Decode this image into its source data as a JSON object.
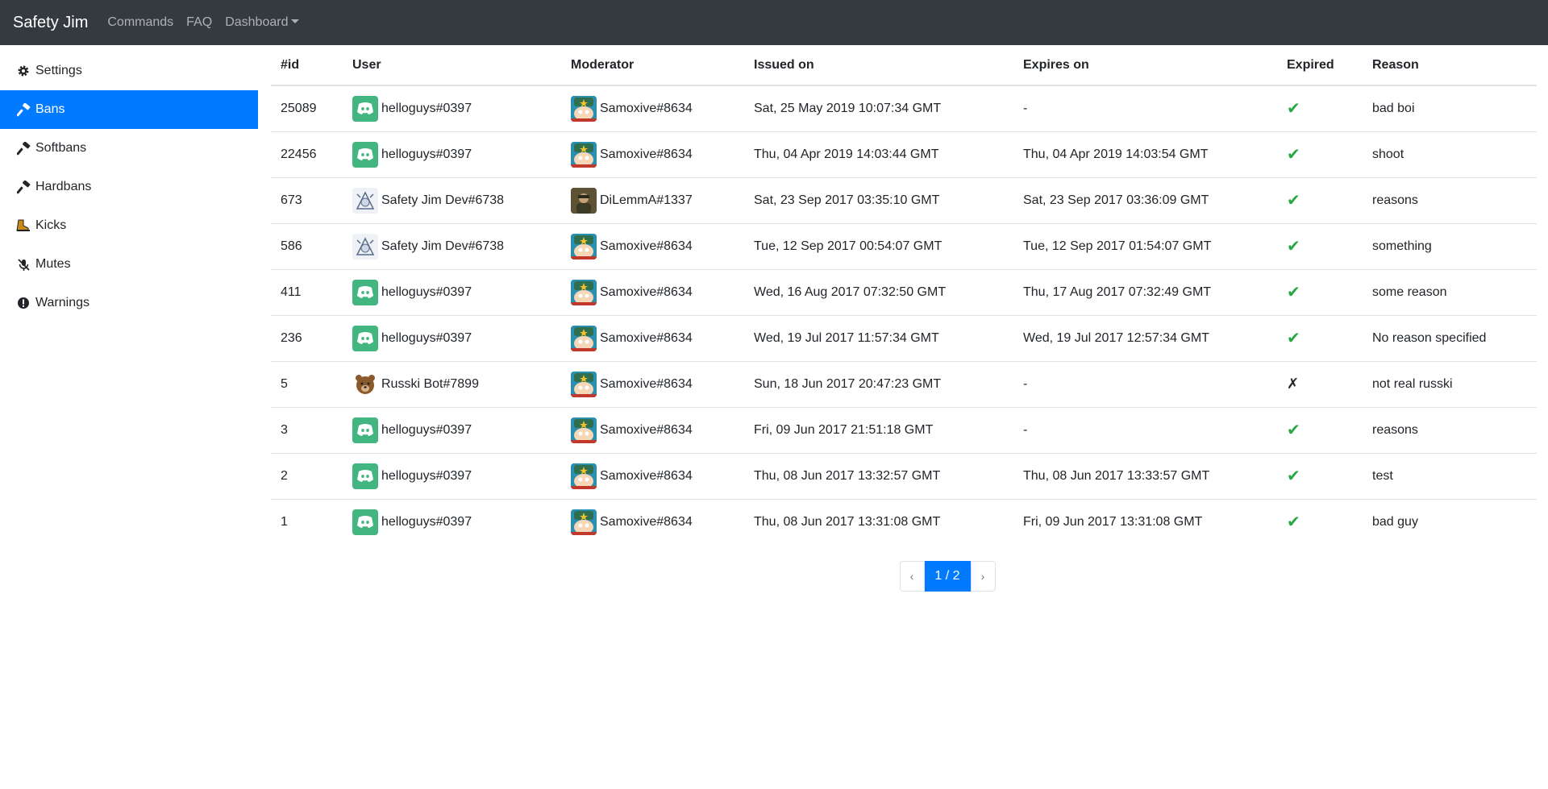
{
  "navbar": {
    "brand": "Safety Jim",
    "links": [
      "Commands",
      "FAQ"
    ],
    "dashboard": "Dashboard"
  },
  "sidebar": {
    "items": [
      {
        "label": "Settings",
        "icon": "gear-icon"
      },
      {
        "label": "Bans",
        "icon": "hammer-icon",
        "active": true
      },
      {
        "label": "Softbans",
        "icon": "hammer-icon"
      },
      {
        "label": "Hardbans",
        "icon": "hammer-icon"
      },
      {
        "label": "Kicks",
        "icon": "boot-icon"
      },
      {
        "label": "Mutes",
        "icon": "muted-mic-icon"
      },
      {
        "label": "Warnings",
        "icon": "exclamation-icon"
      }
    ]
  },
  "table": {
    "headers": [
      "#id",
      "User",
      "Moderator",
      "Issued on",
      "Expires on",
      "Expired",
      "Reason"
    ],
    "rows": [
      {
        "id": "25089",
        "user": "helloguys#0397",
        "user_avatar": "discord",
        "moderator": "Samoxive#8634",
        "mod_avatar": "samo",
        "issued": "Sat, 25 May 2019 10:07:34 GMT",
        "expires": "-",
        "expired": "✔",
        "reason": "bad boi"
      },
      {
        "id": "22456",
        "user": "helloguys#0397",
        "user_avatar": "discord",
        "moderator": "Samoxive#8634",
        "mod_avatar": "samo",
        "issued": "Thu, 04 Apr 2019 14:03:44 GMT",
        "expires": "Thu, 04 Apr 2019 14:03:54 GMT",
        "expired": "✔",
        "reason": "shoot"
      },
      {
        "id": "673",
        "user": "Safety Jim Dev#6738",
        "user_avatar": "dev",
        "moderator": "DiLemmA#1337",
        "mod_avatar": "dilemma",
        "issued": "Sat, 23 Sep 2017 03:35:10 GMT",
        "expires": "Sat, 23 Sep 2017 03:36:09 GMT",
        "expired": "✔",
        "reason": "reasons"
      },
      {
        "id": "586",
        "user": "Safety Jim Dev#6738",
        "user_avatar": "dev",
        "moderator": "Samoxive#8634",
        "mod_avatar": "samo",
        "issued": "Tue, 12 Sep 2017 00:54:07 GMT",
        "expires": "Tue, 12 Sep 2017 01:54:07 GMT",
        "expired": "✔",
        "reason": "something"
      },
      {
        "id": "411",
        "user": "helloguys#0397",
        "user_avatar": "discord",
        "moderator": "Samoxive#8634",
        "mod_avatar": "samo",
        "issued": "Wed, 16 Aug 2017 07:32:50 GMT",
        "expires": "Thu, 17 Aug 2017 07:32:49 GMT",
        "expired": "✔",
        "reason": "some reason"
      },
      {
        "id": "236",
        "user": "helloguys#0397",
        "user_avatar": "discord",
        "moderator": "Samoxive#8634",
        "mod_avatar": "samo",
        "issued": "Wed, 19 Jul 2017 11:57:34 GMT",
        "expires": "Wed, 19 Jul 2017 12:57:34 GMT",
        "expired": "✔",
        "reason": "No reason specified"
      },
      {
        "id": "5",
        "user": "Russki Bot#7899",
        "user_avatar": "bear",
        "moderator": "Samoxive#8634",
        "mod_avatar": "samo",
        "issued": "Sun, 18 Jun 2017 20:47:23 GMT",
        "expires": "-",
        "expired": "✗",
        "reason": "not real russki"
      },
      {
        "id": "3",
        "user": "helloguys#0397",
        "user_avatar": "discord",
        "moderator": "Samoxive#8634",
        "mod_avatar": "samo",
        "issued": "Fri, 09 Jun 2017 21:51:18 GMT",
        "expires": "-",
        "expired": "✔",
        "reason": "reasons"
      },
      {
        "id": "2",
        "user": "helloguys#0397",
        "user_avatar": "discord",
        "moderator": "Samoxive#8634",
        "mod_avatar": "samo",
        "issued": "Thu, 08 Jun 2017 13:32:57 GMT",
        "expires": "Thu, 08 Jun 2017 13:33:57 GMT",
        "expired": "✔",
        "reason": "test"
      },
      {
        "id": "1",
        "user": "helloguys#0397",
        "user_avatar": "discord",
        "moderator": "Samoxive#8634",
        "mod_avatar": "samo",
        "issued": "Thu, 08 Jun 2017 13:31:08 GMT",
        "expires": "Fri, 09 Jun 2017 13:31:08 GMT",
        "expired": "✔",
        "reason": "bad guy"
      }
    ]
  },
  "pagination": {
    "prev": "‹",
    "current": "1 / 2",
    "next": "›"
  },
  "colors": {
    "navbar": "#343a40",
    "active": "#007bff",
    "check": "#28a745",
    "discord": "#43b581"
  }
}
